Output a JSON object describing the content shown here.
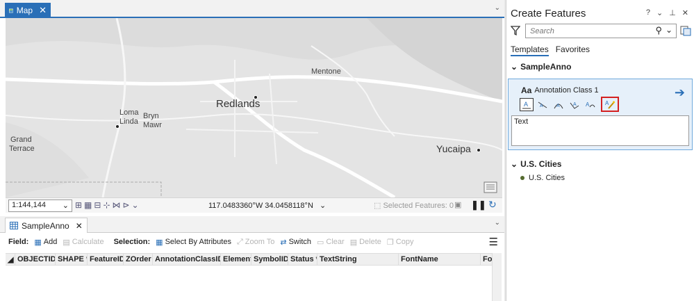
{
  "map_tab": {
    "label": "Map"
  },
  "map_labels": {
    "mentone": "Mentone",
    "loma_linda_1": "Loma",
    "loma_linda_2": "Linda",
    "bryn_mawr_1": "Bryn",
    "bryn_mawr_2": "Mawr",
    "redlands": "Redlands",
    "grand_terrace_1": "Grand",
    "grand_terrace_2": "Terrace",
    "yucaipa": "Yucaipa"
  },
  "map_status": {
    "scale": "1:144,144",
    "coordinates": "117.0483360°W 34.0458118°N",
    "selected_features": "Selected Features: 0"
  },
  "table_tab": {
    "label": "SampleAnno"
  },
  "table_toolbar": {
    "field_label": "Field:",
    "add": "Add",
    "calculate": "Calculate",
    "selection_label": "Selection:",
    "select_by_attributes": "Select By Attributes",
    "zoom_to": "Zoom To",
    "switch": "Switch",
    "clear": "Clear",
    "delete": "Delete",
    "copy": "Copy"
  },
  "table": {
    "columns": [
      "OBJECTID *",
      "SHAPE *",
      "FeatureID",
      "ZOrder",
      "AnnotationClassID *",
      "Element",
      "SymbolID",
      "Status *",
      "TextString",
      "FontName",
      "Fo"
    ]
  },
  "pane": {
    "title": "Create Features",
    "ctrl_help": "?",
    "search_placeholder": "Search",
    "tab_templates": "Templates",
    "tab_favorites": "Favorites",
    "group_sampleanno": "SampleAnno",
    "anno_aa": "Aa",
    "anno_class": "Annotation Class 1",
    "text_value": "Text",
    "group_cities": "U.S. Cities",
    "cities_item": "U.S. Cities"
  },
  "colors": {
    "accent": "#2a6fb7",
    "highlight": "#d42020",
    "panel_bg": "#e6f0fa"
  }
}
